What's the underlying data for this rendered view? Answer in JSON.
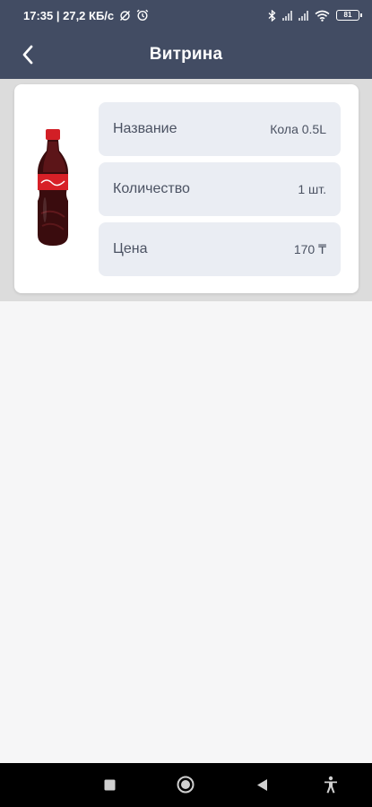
{
  "status_bar": {
    "left_text": "17:35 | 27,2 КБ/с",
    "battery": "81"
  },
  "header": {
    "title": "Витрина"
  },
  "product": {
    "fields": [
      {
        "label": "Название",
        "value": "Кола 0.5L"
      },
      {
        "label": "Количество",
        "value": "1 шт."
      },
      {
        "label": "Цена",
        "value": "170 ₸"
      }
    ]
  },
  "icons": {
    "back": "chevron-left-icon",
    "home": "home-circle-icon",
    "recents": "square-icon",
    "nav_back": "triangle-back-icon",
    "accessibility": "accessibility-icon"
  },
  "colors": {
    "header_bg": "#424c63",
    "field_bg": "#eaedf3",
    "page_bg": "#f6f6f7"
  }
}
